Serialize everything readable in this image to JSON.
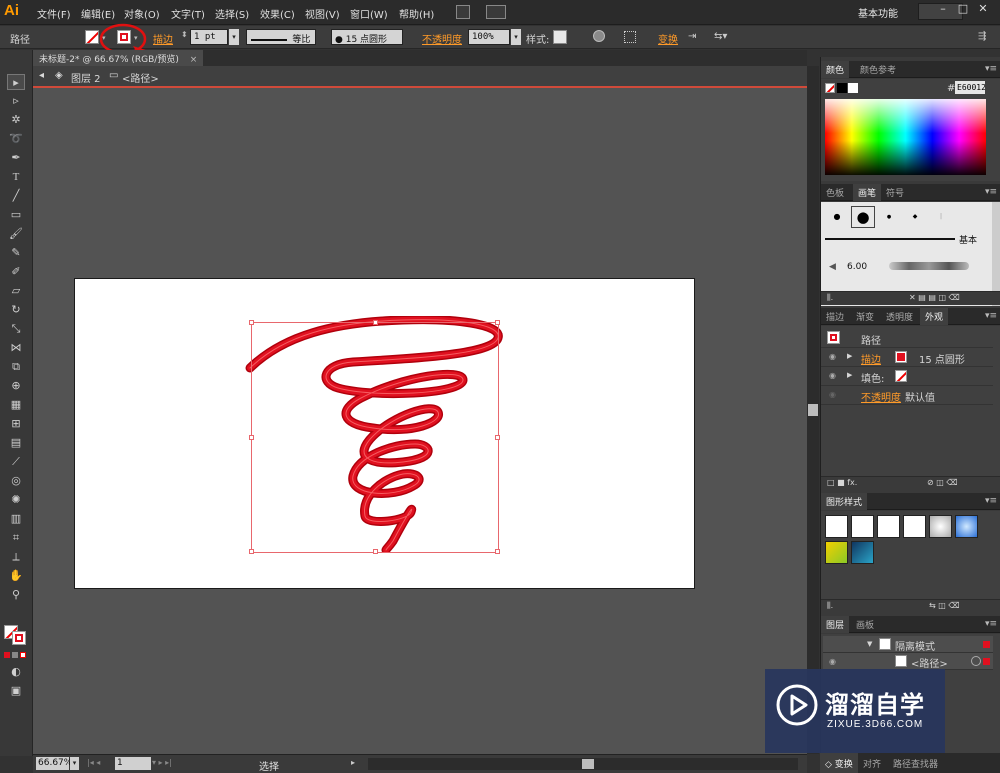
{
  "app": {
    "logo": "Ai",
    "workspace": "基本功能"
  },
  "menu": [
    "文件(F)",
    "编辑(E)",
    "对象(O)",
    "文字(T)",
    "选择(S)",
    "效果(C)",
    "视图(V)",
    "窗口(W)",
    "帮助(H)"
  ],
  "control": {
    "object_type": "路径",
    "stroke_label": "描边",
    "stroke_weight": "1 pt",
    "profile": "等比",
    "brush": "15 点圆形",
    "opacity_label": "不透明度",
    "opacity": "100%",
    "style_label": "样式:",
    "transform_label": "变换"
  },
  "document": {
    "tab": "未标题-2* @ 66.67% (RGB/预览)"
  },
  "breadcrumb": {
    "layer": "图层 2",
    "path": "<路径>"
  },
  "status": {
    "zoom": "66.67%",
    "page": "1",
    "tool": "选择"
  },
  "colors": {
    "stroke_accent": "#e0101f",
    "highlight": "#ff9a28",
    "arrow": "#e01010"
  },
  "panels": {
    "color": {
      "tabs": [
        "颜色",
        "颜色参考"
      ],
      "hex_prefix": "#",
      "hex": "E60012"
    },
    "brushes": {
      "tabs": [
        "色板",
        "画笔",
        "符号"
      ],
      "basic_label": "基本",
      "brush_size": "6.00"
    },
    "appearance": {
      "tabs": [
        "描边",
        "渐变",
        "透明度",
        "外观"
      ],
      "title": "路径",
      "stroke_label": "描边",
      "stroke_value": "15 点圆形",
      "fill_label": "填色:",
      "opacity_label": "不透明度",
      "opacity_value": "默认值"
    },
    "graphic_styles": {
      "tabs": [
        "图形样式"
      ]
    },
    "layers": {
      "tabs": [
        "图层",
        "画板"
      ],
      "isolation": "隔离模式",
      "path": "<路径>"
    },
    "bottom_tabs": [
      "变换",
      "对齐",
      "路径查找器"
    ]
  },
  "watermark": {
    "title": "溜溜自学",
    "url": "ZIXUE.3D66.COM"
  }
}
